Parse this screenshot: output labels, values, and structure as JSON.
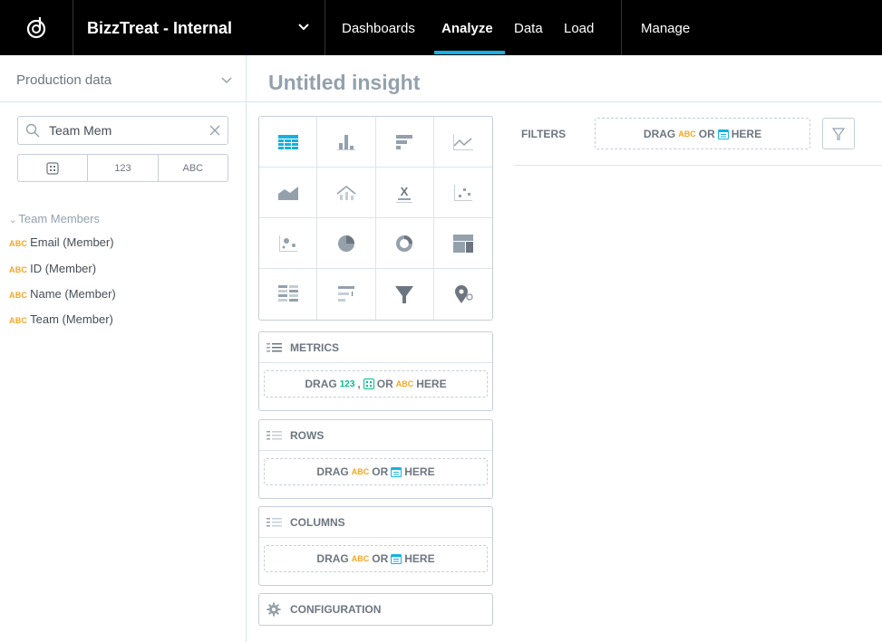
{
  "header": {
    "workspace": "BizzTreat - Internal",
    "nav": [
      "Dashboards",
      "Analyze",
      "Data",
      "Load",
      "Manage"
    ]
  },
  "sidebar": {
    "project": "Production data",
    "search_value": "Team Mem",
    "type_filters": [
      "123",
      "ABC"
    ],
    "group_label": "Team Members",
    "fields": [
      {
        "tag": "ABC",
        "label": "Email (Member)"
      },
      {
        "tag": "ABC",
        "label": "ID (Member)"
      },
      {
        "tag": "ABC",
        "label": "Name (Member)"
      },
      {
        "tag": "ABC",
        "label": "Team (Member)"
      }
    ]
  },
  "main": {
    "title": "Untitled insight",
    "metrics": {
      "label": "METRICS",
      "drag": "DRAG",
      "num": "123",
      "comma": ",",
      "or": "OR",
      "abc": "ABC",
      "here": "HERE"
    },
    "rows": {
      "label": "ROWS",
      "drag": "DRAG",
      "abc": "ABC",
      "or": "OR",
      "here": "HERE"
    },
    "columns": {
      "label": "COLUMNS",
      "drag": "DRAG",
      "abc": "ABC",
      "or": "OR",
      "here": "HERE"
    },
    "configuration": "CONFIGURATION",
    "filters": {
      "label": "FILTERS",
      "drag": "DRAG",
      "abc": "ABC",
      "or": "OR",
      "here": "HERE"
    }
  },
  "colors": {
    "accent": "#14b2e2",
    "attribute": "#f5a623",
    "metric": "#00c18d"
  }
}
